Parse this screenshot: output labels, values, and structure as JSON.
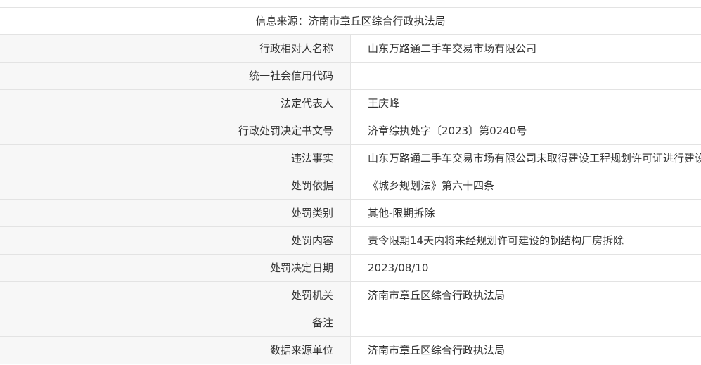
{
  "header": {
    "source_text": "信息来源：济南市章丘区综合行政执法局"
  },
  "rows": [
    {
      "label": "行政相对人名称",
      "value": "山东万路通二手车交易市场有限公司"
    },
    {
      "label": "统一社会信用代码",
      "value": ""
    },
    {
      "label": "法定代表人",
      "value": "王庆峰"
    },
    {
      "label": "行政处罚决定书文号",
      "value": "济章综执处字〔2023〕第0240号"
    },
    {
      "label": "违法事实",
      "value": "山东万路通二手车交易市场有限公司未取得建设工程规划许可证进行建设行为的处罚案"
    },
    {
      "label": "处罚依据",
      "value": "《城乡规划法》第六十四条"
    },
    {
      "label": "处罚类别",
      "value": "其他-限期拆除"
    },
    {
      "label": "处罚内容",
      "value": "责令限期14天内将未经规划许可建设的钢结构厂房拆除"
    },
    {
      "label": "处罚决定日期",
      "value": "2023/08/10"
    },
    {
      "label": "处罚机关",
      "value": "济南市章丘区综合行政执法局"
    },
    {
      "label": "备注",
      "value": ""
    },
    {
      "label": "数据来源单位",
      "value": "济南市章丘区综合行政执法局"
    }
  ]
}
